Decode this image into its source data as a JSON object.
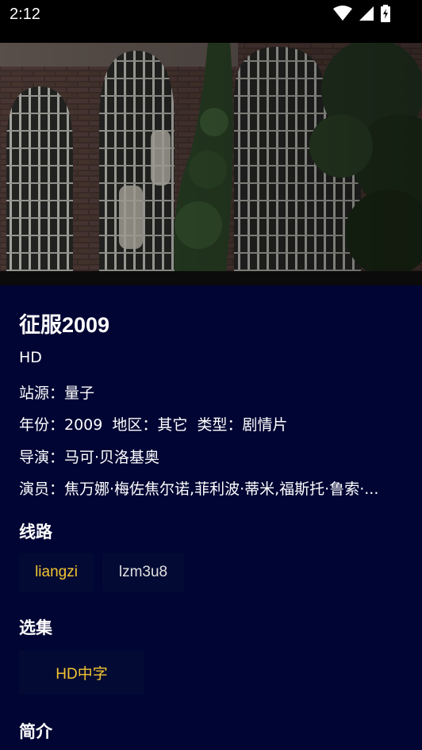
{
  "status_bar": {
    "time": "2:12",
    "icons": [
      "wifi-icon",
      "signal-icon",
      "battery-charging-icon"
    ]
  },
  "video": {
    "description_icon": "video-player"
  },
  "movie": {
    "title": "征服2009",
    "quality": "HD",
    "source_line": "站源：量子",
    "info_line": "年份：2009  地区：其它  类型：剧情片",
    "director_line": "导演：马可·贝洛基奥",
    "cast_line": "演员：焦万娜·梅佐焦尔诺,菲利波·蒂米,福斯托·鲁索·..."
  },
  "routes": {
    "heading": "线路",
    "items": [
      {
        "label": "liangzi",
        "active": true
      },
      {
        "label": "lzm3u8",
        "active": false
      }
    ]
  },
  "episodes": {
    "heading": "选集",
    "items": [
      {
        "label": "HD中字",
        "active": true
      }
    ]
  },
  "intro": {
    "heading": "简介"
  },
  "colors": {
    "background": "#000533",
    "chip_bg": "#030a33",
    "accent": "#f2c431"
  }
}
